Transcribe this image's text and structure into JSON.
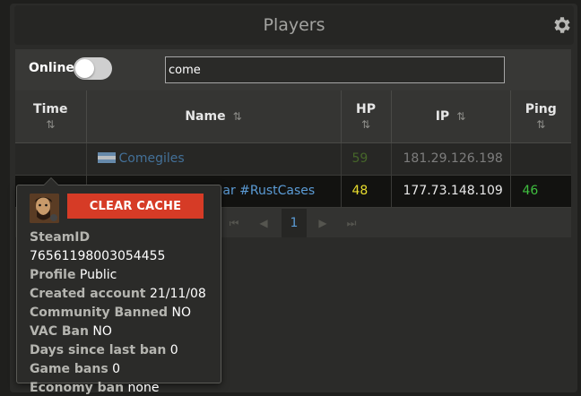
{
  "header": {
    "title": "Players"
  },
  "filters": {
    "online_label": "Online",
    "online_enabled": false,
    "search_value": "come"
  },
  "table": {
    "columns": [
      "Time",
      "Name",
      "HP",
      "IP",
      "Ping"
    ],
    "sort_glyph": "⇅",
    "rows": [
      {
        "time": "",
        "name": "Comegiles",
        "hp": "59",
        "ip": "181.29.126.198",
        "ping": ""
      },
      {
        "time": "",
        "name": "gar #RustCases",
        "hp": "48",
        "ip": "177.73.148.109",
        "ping": "46"
      }
    ]
  },
  "pager": {
    "first": "⏮",
    "prev": "◀",
    "current": "1",
    "next": "▶",
    "last": "⏭"
  },
  "popover": {
    "clear_label": "CLEAR CACHE",
    "fields": [
      {
        "label": "SteamID",
        "value": "76561198003054455"
      },
      {
        "label": "Profile",
        "value": "Public"
      },
      {
        "label": "Created account",
        "value": "21/11/08"
      },
      {
        "label": "Community Banned",
        "value": "NO"
      },
      {
        "label": "VAC Ban",
        "value": "NO"
      },
      {
        "label": "Days since last ban",
        "value": "0"
      },
      {
        "label": "Game bans",
        "value": "0"
      },
      {
        "label": "Economy ban",
        "value": "none"
      }
    ]
  },
  "colors": {
    "accent": "#5b9bd5",
    "danger": "#d63b26",
    "hp": "#e8dd2e",
    "ping_good": "#3fbf3f"
  }
}
